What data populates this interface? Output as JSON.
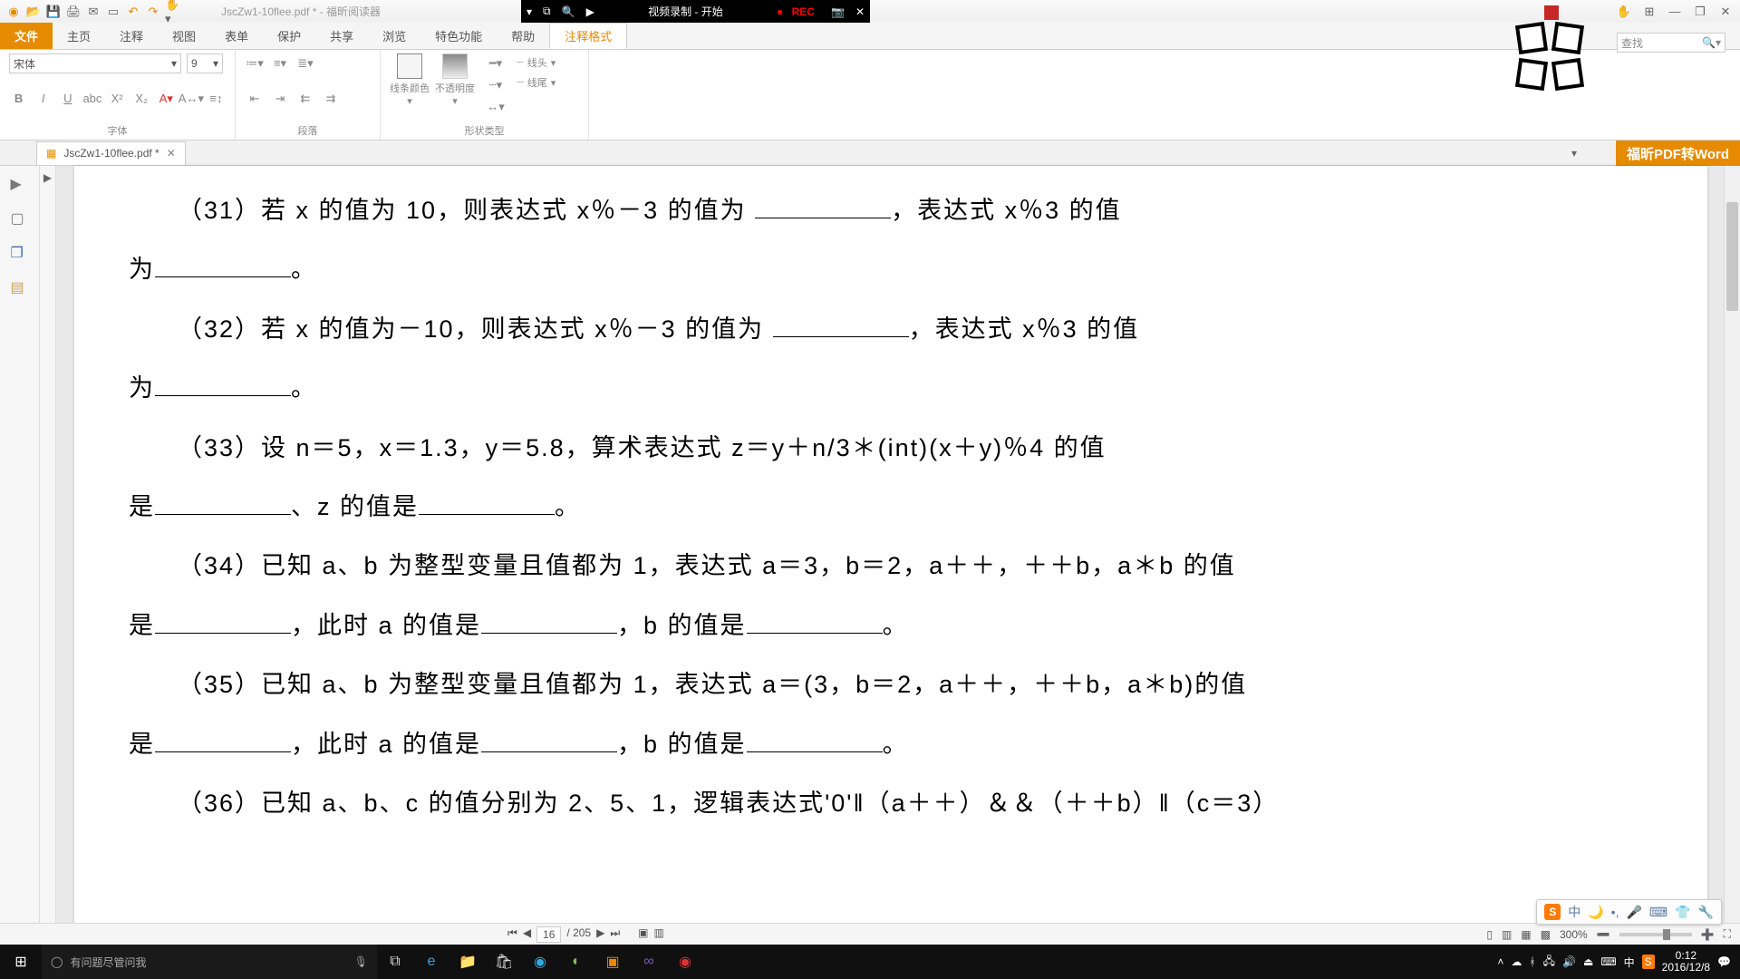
{
  "qat": {
    "title": "JscZw1-10flee.pdf * - 福昕阅读器"
  },
  "recorder": {
    "label": "视频录制 - 开始",
    "rec": "REC"
  },
  "tabs": {
    "file": "文件",
    "home": "主页",
    "annot": "注释",
    "view": "视图",
    "form": "表单",
    "protect": "保护",
    "share": "共享",
    "browse": "浏览",
    "feature": "特色功能",
    "help": "帮助",
    "fmt": "注释格式"
  },
  "ribbon": {
    "font_name": "宋体",
    "font_size": "9",
    "group_font": "字体",
    "group_para": "段落",
    "group_shape": "形状类型",
    "linecolor": "线条颜色",
    "opacity": "不透明度",
    "linehead": "线头",
    "linetail": "线尾"
  },
  "doctab": {
    "name": "JscZw1-10flee.pdf *"
  },
  "pdf2word": "福昕PDF转Word",
  "findbox": "查找",
  "content": {
    "l31a": "（31）若 x 的值为 10，则表达式 x％－3 的值为 ",
    "l31b": "，表达式 x％3 的值",
    "l31c": "为",
    "l32a": "（32）若 x 的值为－10，则表达式 x％－3 的值为 ",
    "l32b": "，表达式 x％3 的值",
    "l32c": "为",
    "l33a": "（33）设 n＝5，x＝1.3，y＝5.8，算术表达式 z＝y＋n/3＊(int)(x＋y)％4 的值",
    "l33b": "是",
    "l33c": "、z 的值是",
    "l34a": "（34）已知 a、b 为整型变量且值都为 1，表达式 a＝3，b＝2，a＋＋，＋＋b，a＊b 的值",
    "l34b": "是",
    "l34c": "，此时 a 的值是",
    "l34d": "，b 的值是",
    "l35a": "（35）已知 a、b 为整型变量且值都为 1，表达式 a＝(3，b＝2，a＋＋，＋＋b，a＊b)的值",
    "l35b": "是",
    "l35c": "，此时 a 的值是",
    "l35d": "，b 的值是",
    "l36a": "（36）已知 a、b、c 的值分别为 2、5、1，逻辑表达式'0'‖（a＋＋）＆＆（＋＋b）‖（c＝3）",
    "period": "。"
  },
  "pagenav": {
    "page": "16",
    "total": "/ 205",
    "zoom": "300%"
  },
  "taskbar": {
    "search": "有问题尽管问我",
    "time": "0:12",
    "date": "2016/12/8",
    "ime": "中"
  },
  "ime_float": "中"
}
